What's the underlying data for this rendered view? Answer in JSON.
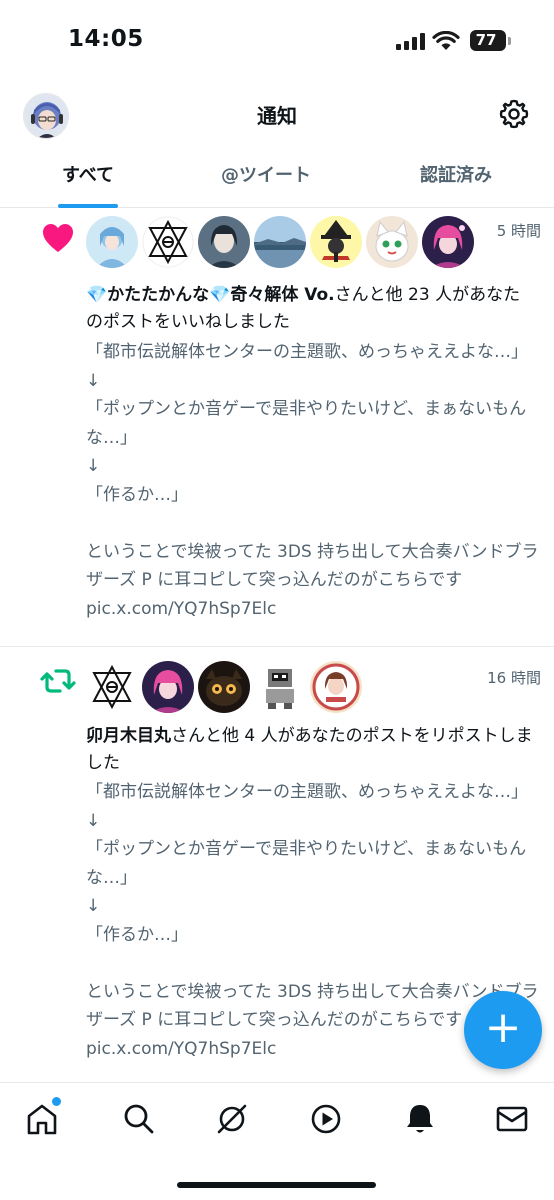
{
  "status_bar": {
    "time": "14:05",
    "battery": "77"
  },
  "header": {
    "title": "通知"
  },
  "tabs": [
    {
      "label": "すべて",
      "active": true
    },
    {
      "label": "@ツイート",
      "active": false
    },
    {
      "label": "認証済み",
      "active": false
    }
  ],
  "notifications": [
    {
      "type": "like",
      "time": "5 時間",
      "actor": "💎かたたかんな💎奇々解体 Vo.",
      "action": "さんと他 23 人があなたのポストをいいねしました",
      "body": "「都市伝説解体センターの主題歌、めっちゃええよな…」\n↓\n「ポップンとか音ゲーで是非やりたいけど、まぁないもんな…」\n↓\n「作るか…」\n\nということで埃被ってた 3DS 持ち出して大合奏バンドブラザーズ P に耳コピして突っ込んだのがこちらです pic.x.com/YQ7hSp7Elc"
    },
    {
      "type": "repost",
      "time": "16 時間",
      "actor": "卯月木目丸",
      "action": "さんと他 4 人があなたのポストをリポストしました",
      "body": "「都市伝説解体センターの主題歌、めっちゃええよな…」\n↓\n「ポップンとか音ゲーで是非やりたいけど、まぁないもんな…」\n↓\n「作るか…」\n\nということで埃被ってた 3DS 持ち出して大合奏バンドブラザーズ P に耳コピして突っ込んだのがこちらです pic.x.com/YQ7hSp7Elc"
    }
  ],
  "colors": {
    "accent": "#1d9bf0",
    "like": "#f91880",
    "repost": "#00ba7c",
    "secondary_text": "#536471"
  },
  "icons": {
    "header": [
      "avatar",
      "gear-icon"
    ],
    "bottom_nav": [
      "home-icon",
      "search-icon",
      "grok-icon",
      "video-icon",
      "bell-icon",
      "mail-icon"
    ],
    "fab": "plus-icon"
  }
}
